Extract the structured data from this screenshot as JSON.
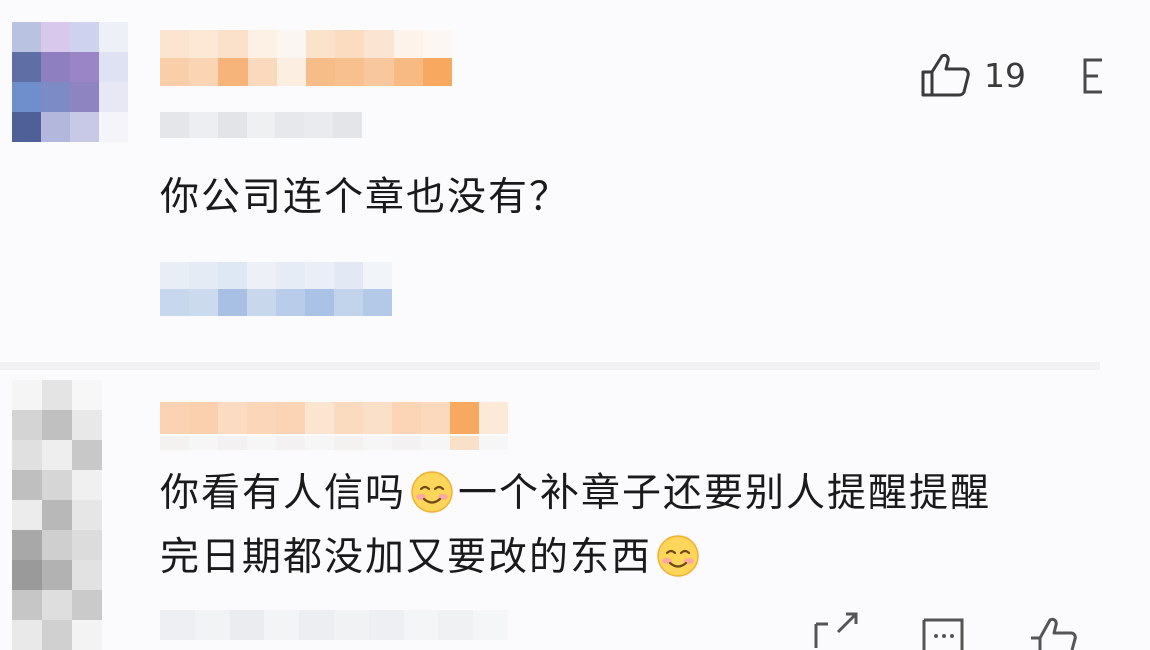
{
  "comments": [
    {
      "likes": "19",
      "text": "你公司连个章也没有？"
    },
    {
      "text_line1": "你看有人信吗",
      "text_line1b": "一个补章子还要别人提醒提醒",
      "text_line2": "完日期都没加又要改的东西"
    }
  ],
  "icons": {
    "like": "thumb-up-icon",
    "menu": "more-icon",
    "emoji": "smiling-face-emoji",
    "share": "share-icon",
    "comment": "comment-icon"
  },
  "colors": {
    "blur_orange": "#f6b06a",
    "blur_gray": "#d9dbe2",
    "blur_blue": "#bcd1ea"
  }
}
